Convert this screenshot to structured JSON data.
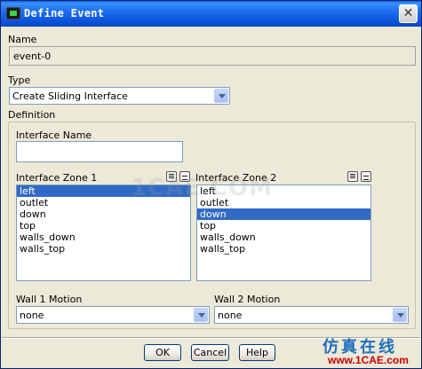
{
  "window": {
    "title": "Define Event",
    "close_glyph": "✕"
  },
  "name_section": {
    "label": "Name",
    "value": "event-0"
  },
  "type_section": {
    "label": "Type",
    "selected": "Create Sliding Interface"
  },
  "definition": {
    "label": "Definition",
    "interface_name": {
      "label": "Interface Name",
      "value": ""
    },
    "zone1": {
      "label": "Interface Zone 1",
      "items": [
        "left",
        "outlet",
        "down",
        "top",
        "walls_down",
        "walls_top"
      ],
      "selected_index": 0
    },
    "zone2": {
      "label": "Interface Zone 2",
      "items": [
        "left",
        "outlet",
        "down",
        "top",
        "walls_down",
        "walls_top"
      ],
      "selected_index": 2
    },
    "wall1": {
      "label": "Wall 1 Motion",
      "selected": "none"
    },
    "wall2": {
      "label": "Wall 2 Motion",
      "selected": "none"
    }
  },
  "buttons": {
    "ok": "OK",
    "cancel": "Cancel",
    "help": "Help"
  },
  "watermark": {
    "text": "1CAE.COM",
    "brand": "仿真在线",
    "url": "www.1CAE.com"
  },
  "colors": {
    "titlebar": "#0a4fd6",
    "selection": "#316ac5",
    "dialog_bg": "#ece9d8"
  }
}
